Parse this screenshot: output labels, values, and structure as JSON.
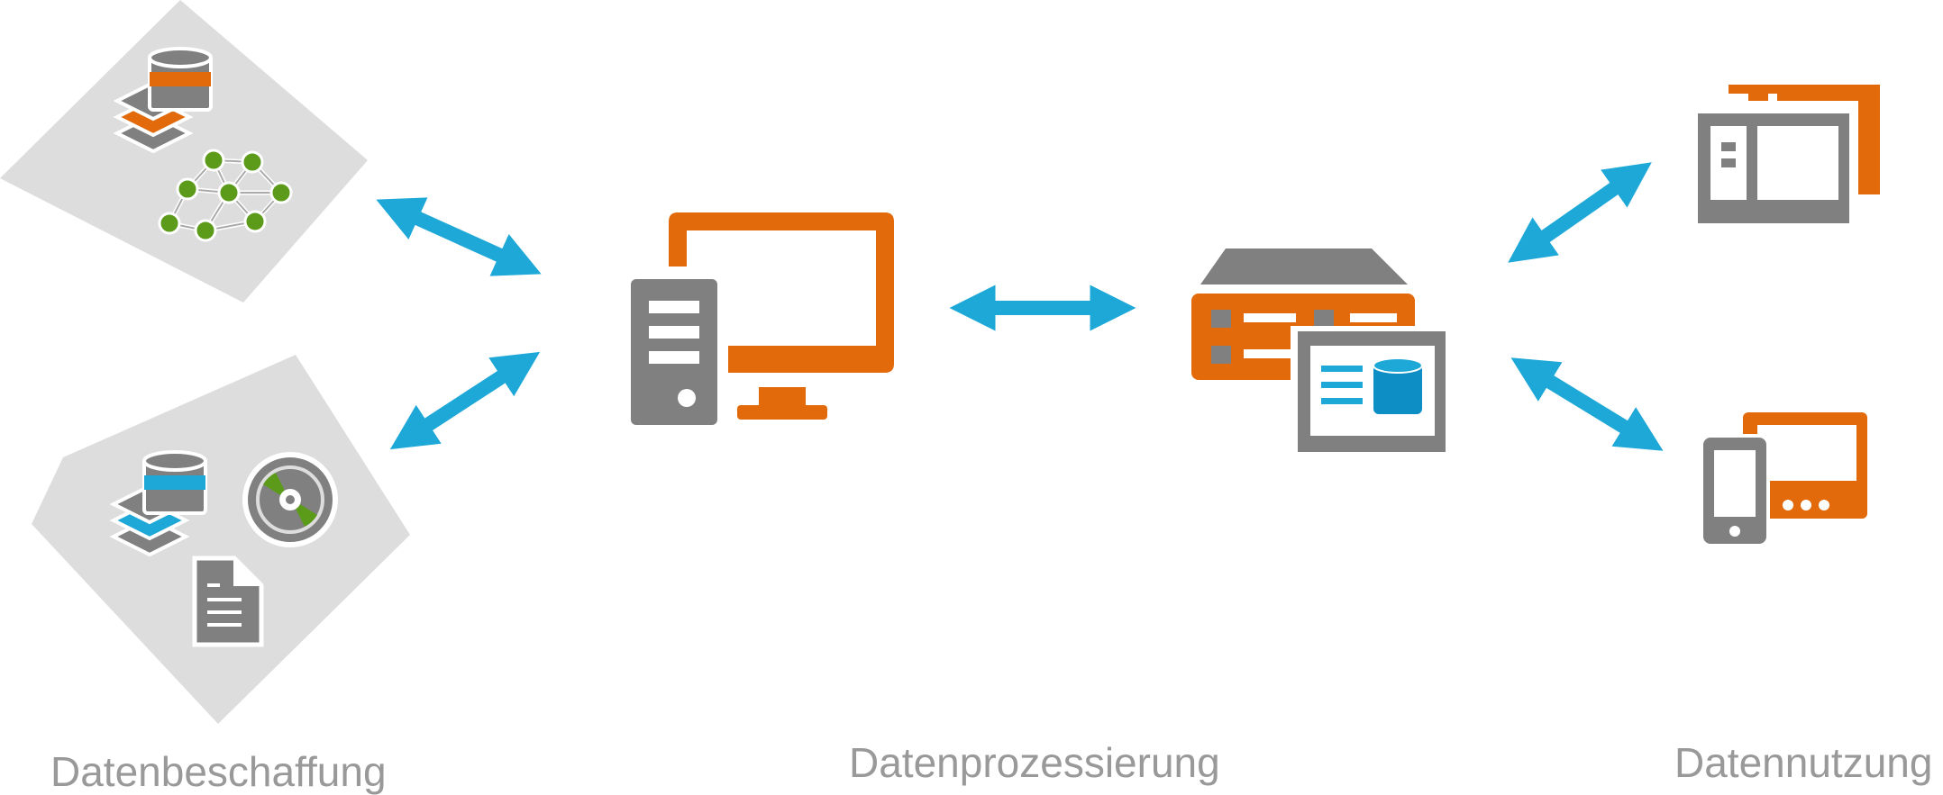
{
  "labels": {
    "acquisition": "Datenbeschaffung",
    "processing": "Datenprozessierung",
    "usage": "Datennutzung"
  },
  "colors": {
    "orange": "#e36a0b",
    "gray": "#808080",
    "light_gray": "#dddddd",
    "blue": "#1ea8d8",
    "green": "#5c9a1a",
    "label": "#999999"
  },
  "icons": [
    "map-sheet-icon",
    "database-icon",
    "layers-icon",
    "network-graph-icon",
    "disc-icon",
    "document-icon",
    "workstation-icon",
    "server-icon",
    "tablet-icon",
    "mobile-devices-icon",
    "double-arrow-icon"
  ]
}
